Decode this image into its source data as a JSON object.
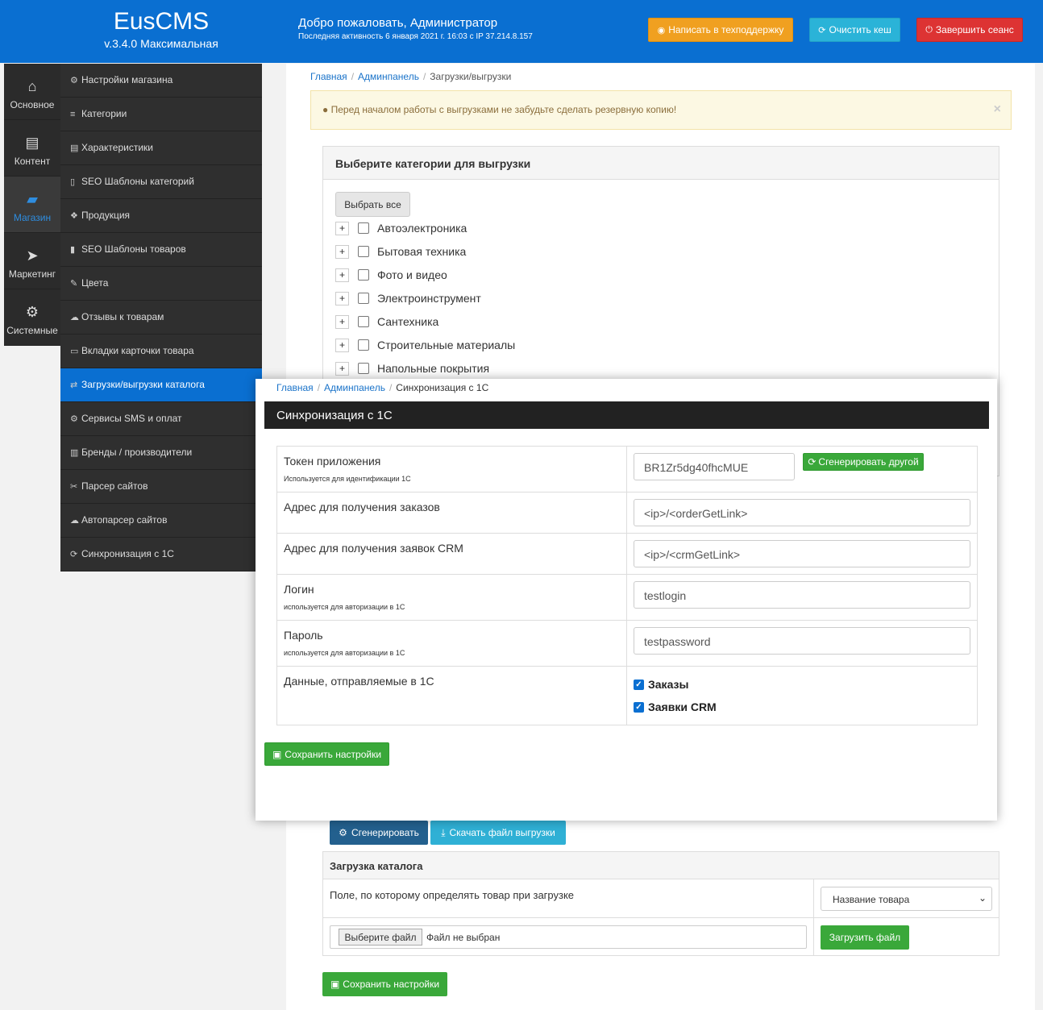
{
  "header": {
    "app_name": "EusCMS",
    "version": "v.3.4.0 Максимальная",
    "welcome": "Добро пожаловать, Администратор",
    "last_activity": "Последняя активность 6 января 2021 г. 16:03 с IP 37.214.8.157",
    "support_label": "Написать в техподдержку",
    "clear_cache_label": "Очистить кеш",
    "logout_label": "Завершить сеанс"
  },
  "iconbar": [
    {
      "label": "Основное",
      "icon": "home-icon"
    },
    {
      "label": "Контент",
      "icon": "document-icon"
    },
    {
      "label": "Магазин",
      "icon": "shopping-bag-icon"
    },
    {
      "label": "Маркетинг",
      "icon": "paper-plane-icon"
    },
    {
      "label": "Системные",
      "icon": "gear-icon"
    }
  ],
  "menu": [
    "Настройки магазина",
    "Категории",
    "Характеристики",
    "SEO Шаблоны категорий",
    "Продукция",
    "SEO Шаблоны товаров",
    "Цвета",
    "Отзывы к товарам",
    "Вкладки карточки товара",
    "Загрузки/выгрузки каталога",
    "Сервисы SMS и оплат",
    "Бренды / производители",
    "Парсер сайтов",
    "Автопарсер сайтов",
    "Синхронизация с 1С"
  ],
  "breadcrumb": [
    "Главная",
    "Админпанель",
    "Загрузки/выгрузки"
  ],
  "alert": "Перед началом работы с выгрузками не забудьте сделать резервную копию!",
  "export_panel": {
    "title": "Выберите категории для выгрузки",
    "select_all": "Выбрать все",
    "categories": [
      "Автоэлектроника",
      "Бытовая техника",
      "Фото и видео",
      "Электроинструмент",
      "Сантехника",
      "Строительные материалы",
      "Напольные покрытия"
    ]
  },
  "actions": {
    "generate": "Сгенерировать",
    "download": "Скачать файл выгрузки"
  },
  "import_panel": {
    "title": "Загрузка каталога",
    "field_label": "Поле, по которому определять товар при загрузке",
    "field_value": "Название товара",
    "file_button": "Выберите файл",
    "file_status": "Файл не выбран",
    "upload": "Загрузить файл",
    "save": "Сохранить настройки"
  },
  "sync": {
    "breadcrumb": [
      "Главная",
      "Админпанель",
      "Синхронизация с 1С"
    ],
    "title": "Синхронизация с 1С",
    "token_label": "Токен приложения",
    "token_sub": "Используется для идентификации 1С",
    "token_value": "BR1Zr5dg40fhcMUE",
    "regen_label": "Сгенерировать другой",
    "orders_label": "Адрес для получения заказов",
    "orders_value": "<ip>/<orderGetLink>",
    "crm_label": "Адрес для получения заявок CRM",
    "crm_value": "<ip>/<crmGetLink>",
    "login_label": "Логин",
    "login_sub": "используется для авторизации в 1С",
    "login_value": "testlogin",
    "password_label": "Пароль",
    "password_sub": "используется для авторизации в 1С",
    "password_value": "testpassword",
    "data_label": "Данные, отправляемые в 1С",
    "check_orders": "Заказы",
    "check_crm": "Заявки CRM",
    "save": "Сохранить настройки"
  },
  "colors": {
    "brand": "#0a6fd1",
    "success": "#3aa83a",
    "danger": "#dd3333",
    "warning": "#f0a020",
    "info": "#2ab3d8"
  }
}
